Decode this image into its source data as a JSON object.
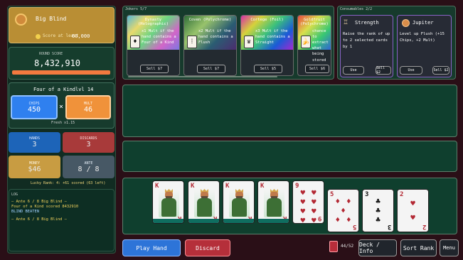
{
  "blind": {
    "name": "Big Blind",
    "score_label": "Score at least",
    "score_value": "60,000"
  },
  "round": {
    "label": "ROUND SCORE",
    "value": "8,432,910"
  },
  "hand": {
    "name": "Four of a Kind",
    "level": "lvl 14",
    "chips_label": "CHIPS",
    "chips": "450",
    "x": "×",
    "mult_label": "MULT",
    "mult": "46",
    "note": "Fresh x1.15"
  },
  "stats": {
    "hands_label": "HANDS",
    "hands": "3",
    "discards_label": "DISCARDS",
    "discards": "3",
    "money_label": "MONEY",
    "money": "$46",
    "ante_label": "ANTE",
    "ante": "8 / 8"
  },
  "lucky": "Lucky Rank: 4: +61 scored (63 left)",
  "log": {
    "title": "LOG",
    "lines": [
      "— Ante 6 / 8 Big Blind —",
      "Four of a Kind scored 8432910",
      "BLIND BEATEN",
      "— Ante 6 / 8 Big Blind —"
    ]
  },
  "jokers": {
    "label": "Jokers 5/7",
    "items": [
      {
        "title": "Dynasty (Holographic)",
        "desc": "x1 Mult if the hand contains a Four of a Kind",
        "sell": "Sell $7",
        "icon": "♦",
        "gradient": "linear-gradient(135deg,#54b7d6,#e8d96d,#6bd483,#d266c8,#7c77e2)"
      },
      {
        "title": "Coven (Polychrome)",
        "desc": "x2 Mult if the hand contains a Flush",
        "sell": "Sell $7",
        "icon": "⁞",
        "gradient": "linear-gradient(135deg,#2f6d39,#98c36b,#2a5c72,#4c2c70)"
      },
      {
        "title": "Cortege (Foil)",
        "desc": "x3 Mult if the hand contains a Straight",
        "sell": "Sell $5",
        "icon": "♛",
        "gradient": "linear-gradient(135deg,#d72ea9,#d6d23b,#3cc17b,#1b5ad7,#a329d1)"
      },
      {
        "title": "Goldfruit (Polychrome)",
        "desc": "chance to extract what being stored",
        "sell": "Sell $6",
        "icon": "🍌",
        "gradient": "linear-gradient(135deg,#ea4a41,#d9df4b,#38c773,#3264d6)"
      }
    ]
  },
  "consumables": {
    "label": "Consumables 2/2",
    "items": [
      {
        "title": "Strength",
        "desc": "Raise the rank of up to 2 selected cards by 1",
        "use": "Use",
        "sell": "Sell $2",
        "icon": "♖"
      },
      {
        "title": "Jupiter",
        "desc": "Level up Flush (+15 Chips, +2 Mult)",
        "use": "Use",
        "sell": "Sell $2",
        "icon": "♃"
      }
    ]
  },
  "hand_cards": [
    {
      "rank": "K",
      "suit": "♦",
      "type": "king",
      "color": "red"
    },
    {
      "rank": "K",
      "suit": "♦",
      "type": "king",
      "color": "red"
    },
    {
      "rank": "K",
      "suit": "♦",
      "type": "king",
      "color": "red"
    },
    {
      "rank": "K",
      "suit": "♦",
      "type": "king",
      "color": "red"
    },
    {
      "rank": "9",
      "suit": "♥",
      "type": "pips",
      "color": "red"
    },
    {
      "rank": "5",
      "suit": "♦",
      "type": "pips",
      "color": "red"
    },
    {
      "rank": "3",
      "suit": "♣",
      "type": "pips",
      "color": "black"
    },
    {
      "rank": "2",
      "suit": "♥",
      "type": "pips",
      "color": "red"
    }
  ],
  "actions": {
    "play": "Play Hand",
    "discard": "Discard",
    "deck_count": "44/52",
    "deck_info": "Deck / Info",
    "sort": "Sort Rank",
    "menu": "Menu"
  },
  "colors": {
    "chips": "#2f80ef",
    "mult": "#f0923a",
    "hands": "#1d64b8",
    "discards": "#a83a3a",
    "money": "#c89c42",
    "ante": "#475865"
  }
}
